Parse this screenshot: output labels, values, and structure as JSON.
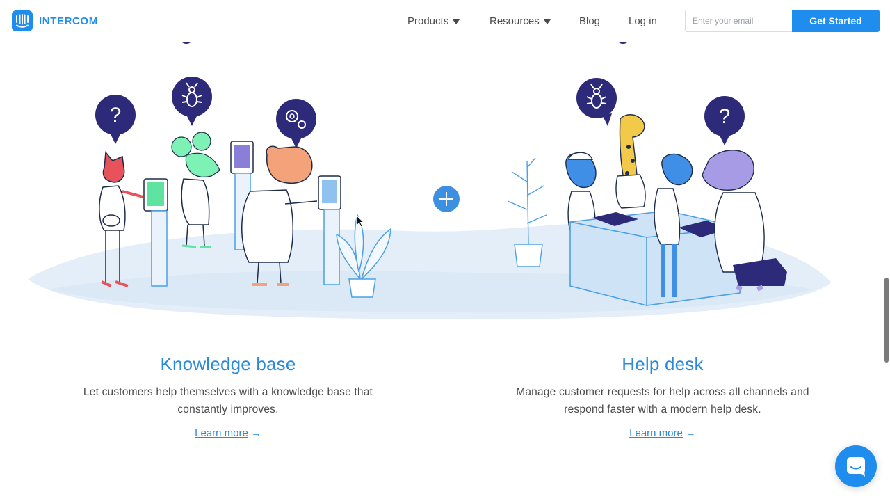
{
  "header": {
    "brand": "INTERCOM",
    "nav": {
      "products": "Products",
      "resources": "Resources",
      "blog": "Blog",
      "login": "Log in"
    },
    "email_placeholder": "Enter your email",
    "cta": "Get Started"
  },
  "features": [
    {
      "title": "Knowledge base",
      "description": "Let customers help themselves with a knowledge base that constantly improves.",
      "link": "Learn more"
    },
    {
      "title": "Help desk",
      "description": "Manage customer requests for help across all channels and respond faster with a modern help desk.",
      "link": "Learn more"
    }
  ],
  "colors": {
    "brand": "#1f8ded",
    "heading": "#2a89d8",
    "bubble": "#2d2a7a",
    "text": "#4a4a4a"
  },
  "icons": [
    "intercom-logo-icon",
    "caret-down-icon",
    "question-icon",
    "bug-icon",
    "gear-icon",
    "plus-icon",
    "arrow-right-icon",
    "chat-icon"
  ]
}
